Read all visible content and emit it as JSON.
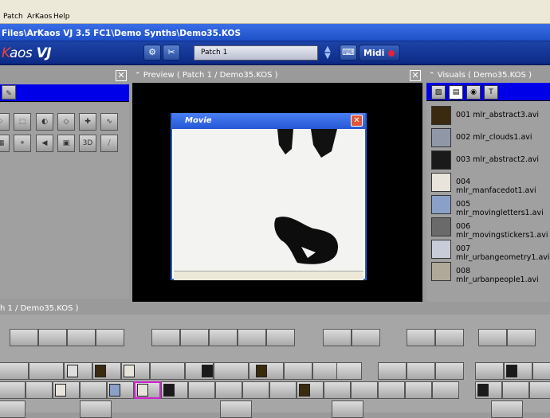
{
  "menu": {
    "items": [
      "Patch",
      "ArKaos",
      "Help"
    ]
  },
  "window": {
    "title": "Files\\ArKaos VJ 3.5 FC1\\Demo Synths\\Demo35.KOS"
  },
  "toolbar": {
    "logo_a": "aos",
    "logo_b": " VJ",
    "logo_k": "K",
    "patch_name": "Patch 1",
    "midi_label": "Midi"
  },
  "preview": {
    "title": "Preview ( Patch 1 / Demo35.KOS )"
  },
  "movie": {
    "title": "Movie"
  },
  "visuals": {
    "title": "Visuals ( Demo35.KOS )",
    "items": [
      "001 mlr_abstract3.avi",
      "002 mlr_clouds1.avi",
      "003 mlr_abstract2.avi",
      "004 mlr_manfacedot1.avi",
      "005 mlr_movingletters1.avi",
      "006 mlr_movingstickers1.avi",
      "007 mlr_urbangeometry1.avi",
      "008 mlr_urbanpeople1.avi"
    ]
  },
  "keyboard": {
    "title": "h 1 / Demo35.KOS )"
  },
  "colors": {
    "accent_blue": "#0000e8",
    "title_blue": "#2556d6",
    "midi_dot": "#e8203a"
  }
}
